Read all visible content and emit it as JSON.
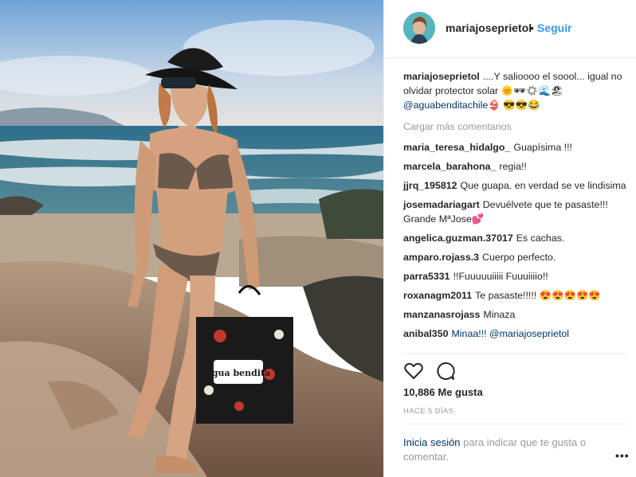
{
  "post": {
    "username": "mariajoseprietol",
    "follow_dot": "•",
    "follow_label": "Seguir",
    "caption_user": "mariajoseprietol",
    "caption_text": "....Y salioooo el soool... igual no olvidar protector solar 🌞🕶☀🌊🏖",
    "caption_mention": "@aguabenditachile",
    "caption_emojis": "👙 😎😎😂",
    "load_more": "Cargar más comentarios",
    "bag_text": "agua bendita",
    "comments": [
      {
        "user": "maria_teresa_hidalgo_",
        "text": "Guapísima !!!"
      },
      {
        "user": "marcela_barahona_",
        "text": "regia!!"
      },
      {
        "user": "jjrq_195812",
        "text": "Que guapa. en verdad se ve lindisima"
      },
      {
        "user": "josemadariagart",
        "text": "Devuélvete que te pasaste!!! Grande MªJose💕"
      },
      {
        "user": "angelica.guzman.37017",
        "text": "Es cachas."
      },
      {
        "user": "amparo.rojass.3",
        "text": "Cuerpo perfecto."
      },
      {
        "user": "parra5331",
        "text": "!!Fuuuuuiiiii Fuuuiiiio!!"
      },
      {
        "user": "roxanagm2011",
        "text": "Te pasaste!!!!! 😍😍😍😍😍"
      },
      {
        "user": "manzanasrojass",
        "text": "Minaza"
      },
      {
        "user": "anibal350",
        "text": "Minaa!!! @mariajoseprietol"
      }
    ],
    "likes": "10,886 Me gusta",
    "time_ago": "HACE 5 DÍAS",
    "login_link": "Inicia sesión",
    "login_text": "para indicar que te gusta o comentar.",
    "more_options": "•••"
  },
  "icons": {
    "like": "heart-icon",
    "comment": "comment-icon",
    "more": "more-options-icon"
  },
  "colors": {
    "link": "#003569",
    "follow": "#3897f0",
    "muted": "#999999",
    "border": "#efefef"
  }
}
